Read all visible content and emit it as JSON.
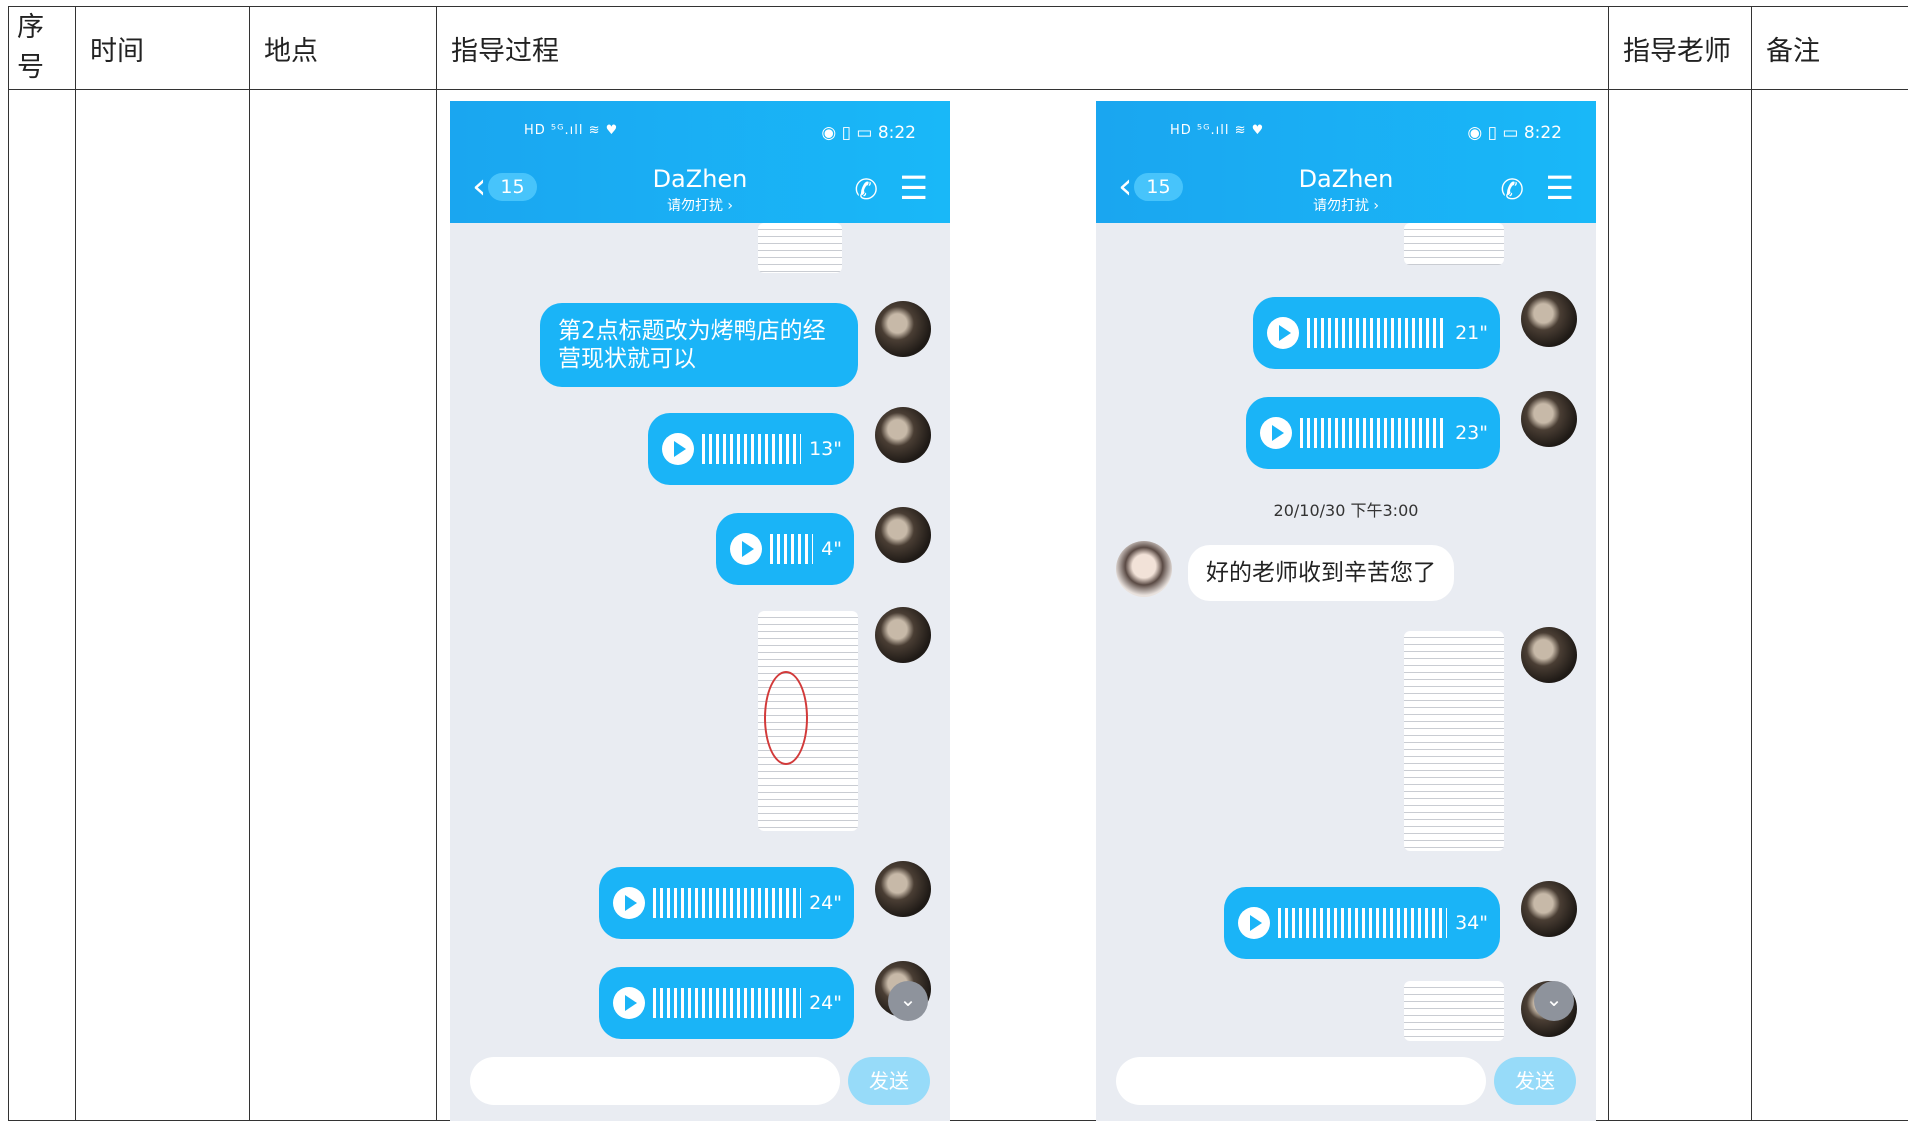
{
  "table": {
    "headers": {
      "seq": "序号",
      "time": "时间",
      "place": "地点",
      "process": "指导过程",
      "teacher": "指导老师",
      "note": "备注"
    }
  },
  "screenshots": [
    {
      "status_left": "HD ⁵ᴳ.ıll ≋ ♥",
      "status_right": "◉ ▯ ▭ 8:22",
      "badge": "15",
      "contact": "DaZhen",
      "subtitle": "请勿打扰 ›",
      "messages": {
        "text1": "第2点标题改为烤鸭店的经营现状就可以",
        "voice1": "13\"",
        "voice2": "4\"",
        "voice3": "24\"",
        "voice4": "24\""
      },
      "send": "发送"
    },
    {
      "status_left": "HD ⁵ᴳ.ıll ≋ ♥",
      "status_right": "◉ ▯ ▭ 8:22",
      "badge": "15",
      "contact": "DaZhen",
      "subtitle": "请勿打扰 ›",
      "messages": {
        "voice1": "21\"",
        "voice2": "23\"",
        "timestamp": "20/10/30 下午3:00",
        "reply": "好的老师收到辛苦您了",
        "voice3": "34\""
      },
      "send": "发送"
    }
  ]
}
